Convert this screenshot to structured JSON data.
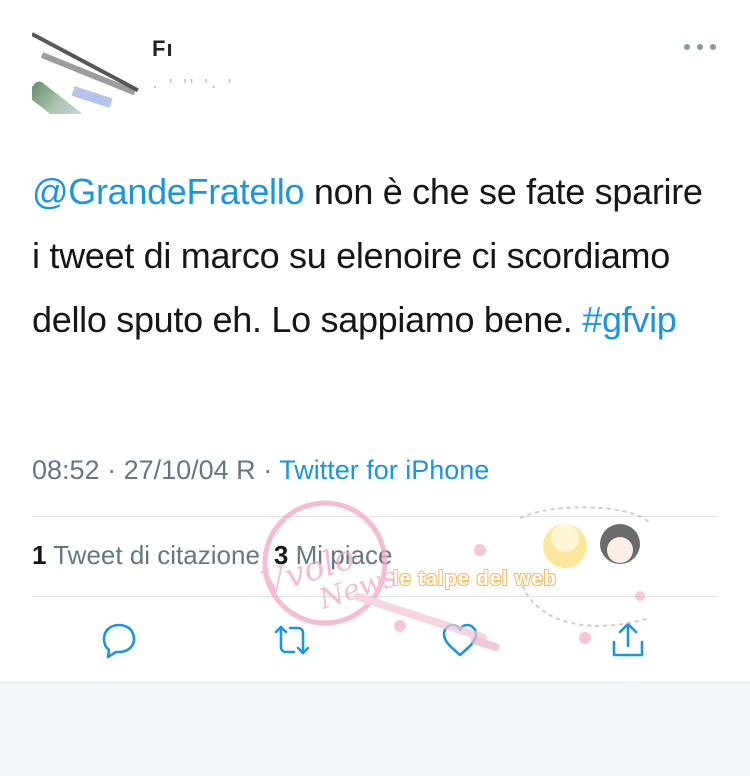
{
  "tweet": {
    "author": {
      "display_name": "Fı",
      "handle": "· ' '' '· '"
    },
    "text_parts": {
      "mention": "@GrandeFratello",
      "body": " non è che se fate sparire i tweet di marco su elenoire ci scordiamo dello sputo eh. Lo sappiamo bene.  ",
      "hashtag": "#gfvip"
    },
    "time": "08:52",
    "separator1": " · ",
    "date": "27/10/04 R",
    "separator2": " · ",
    "source": "Twitter for iPhone",
    "stats": {
      "quote_count": "1",
      "quote_label": "Tweet di citazione",
      "like_count": "3",
      "like_label": "Mi piace"
    },
    "actions": [
      "reply-icon",
      "retweet-icon",
      "like-icon",
      "share-icon"
    ]
  },
  "watermark": {
    "brand_text": "le talpe del web"
  },
  "colors": {
    "link": "#1b95e0",
    "secondary_text": "#657786",
    "divider": "#dfe3e7",
    "icon": "#1b95e0"
  }
}
